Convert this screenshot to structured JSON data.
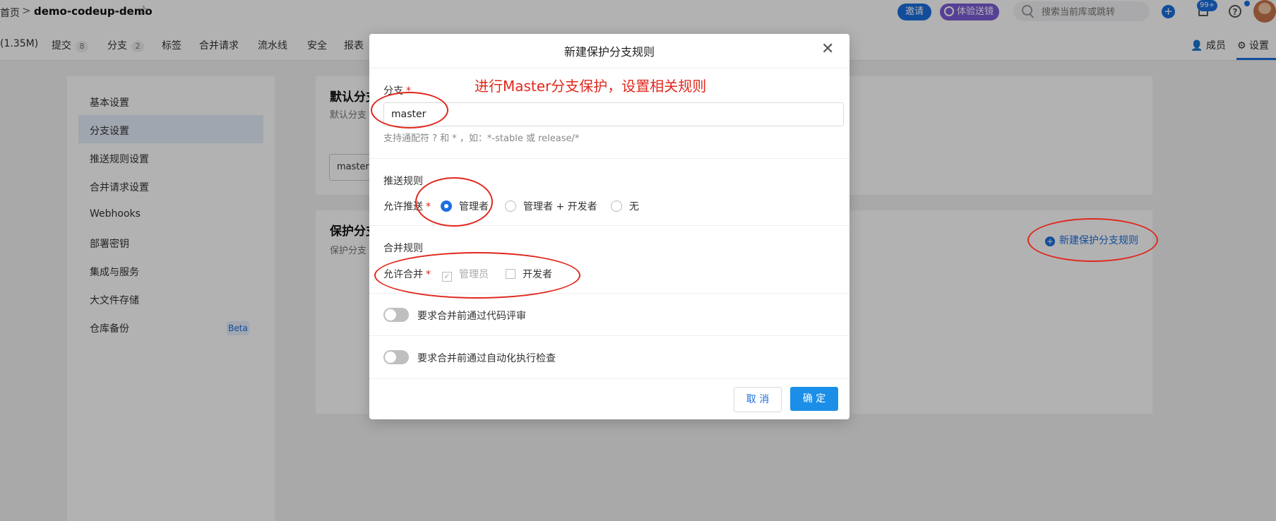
{
  "topbar": {
    "home": "首页",
    "separator": ">",
    "repo": "demo-codeup-demo",
    "invite": "邀请",
    "experience": "体验送镜",
    "search_placeholder": "搜索当前库或跳转",
    "notify_badge": "99+",
    "help": "?"
  },
  "nav": {
    "items": [
      {
        "label": "(1.35M)",
        "count": ""
      },
      {
        "label": "提交",
        "count": "8"
      },
      {
        "label": "分支",
        "count": "2"
      },
      {
        "label": "标签",
        "count": ""
      },
      {
        "label": "合并请求",
        "count": ""
      },
      {
        "label": "流水线",
        "count": ""
      },
      {
        "label": "安全",
        "count": ""
      },
      {
        "label": "报表",
        "count": ""
      }
    ],
    "members": "成员",
    "settings": "设置"
  },
  "sidebar": {
    "items": [
      {
        "label": "基本设置"
      },
      {
        "label": "分支设置"
      },
      {
        "label": "推送规则设置"
      },
      {
        "label": "合并请求设置"
      },
      {
        "label": "Webhooks"
      },
      {
        "label": "部署密钥"
      },
      {
        "label": "集成与服务"
      },
      {
        "label": "大文件存储"
      },
      {
        "label": "仓库备份"
      }
    ],
    "beta": "Beta"
  },
  "default_branch": {
    "title": "默认分支",
    "desc": "默认分支",
    "value": "master"
  },
  "protected_branch": {
    "title": "保护分支",
    "desc": "保护分支",
    "new_rule": "新建保护分支规则"
  },
  "modal": {
    "title": "新建保护分支规则",
    "branch_label": "分支",
    "branch_value": "master",
    "branch_hint": "支持通配符 ? 和 * ，如：*-stable 或 release/*",
    "push_section": "推送规则",
    "allow_push_label": "允许推送",
    "push_options": [
      "管理者",
      "管理者 + 开发者",
      "无"
    ],
    "push_selected": "管理者",
    "merge_section": "合并规则",
    "allow_merge_label": "允许合并",
    "merge_options": [
      {
        "label": "管理员",
        "checked": true,
        "disabled": true
      },
      {
        "label": "开发者",
        "checked": false,
        "disabled": false
      }
    ],
    "toggle_review": "要求合并前通过代码评审",
    "toggle_check": "要求合并前通过自动化执行检查",
    "cancel": "取 消",
    "confirm": "确 定"
  },
  "annotation": {
    "text": "进行Master分支保护，设置相关规则",
    "color": "#e0281d"
  },
  "colors": {
    "primary": "#1b6fe0",
    "confirm_button": "#1b8fe8",
    "annotation_red": "#e0281d"
  }
}
